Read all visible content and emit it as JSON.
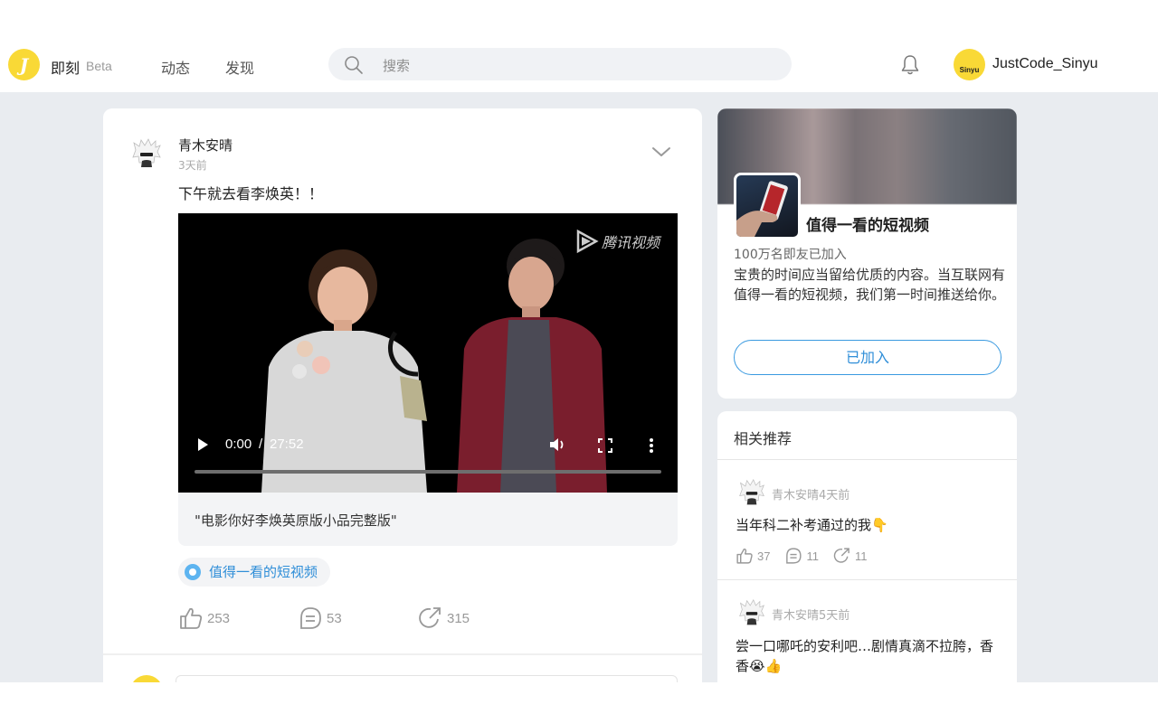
{
  "header": {
    "logo_letter": "J",
    "brand": "即刻",
    "beta": "Beta",
    "nav": [
      "动态",
      "发现"
    ],
    "search_placeholder": "搜索",
    "avatar_text": "Sinyu",
    "username": "JustCode_Sinyu"
  },
  "post": {
    "author": "青木安晴",
    "time": "3天前",
    "text": "下午就去看李焕英！！",
    "video": {
      "watermark": "腾讯视频",
      "current_time": "0:00",
      "separator": "/",
      "duration": "27:52",
      "progress": 0
    },
    "caption": "\"电影你好李焕英原版小品完整版\"",
    "topic": "值得一看的短视频",
    "likes": "253",
    "comments": "53",
    "shares": "315"
  },
  "topic_card": {
    "title": "值得一看的短视频",
    "members": "100万名即友已加入",
    "description": "宝贵的时间应当留给优质的内容。当互联网有值得一看的短视频，我们第一时间推送给你。",
    "join_label": "已加入"
  },
  "recommend": {
    "heading": "相关推荐",
    "items": [
      {
        "author": "青木安晴",
        "time": "4天前",
        "text": "当年科二补考通过的我👇",
        "likes": "37",
        "comments": "11",
        "shares": "11"
      },
      {
        "author": "青木安晴",
        "time": "5天前",
        "text": "尝一口哪吒的安利吧…剧情真滴不拉胯，香香😭👍"
      }
    ]
  },
  "colors": {
    "accent": "#2f8ed8",
    "brand_yellow": "#f9d936",
    "page_bg": "#e9ecf0"
  }
}
